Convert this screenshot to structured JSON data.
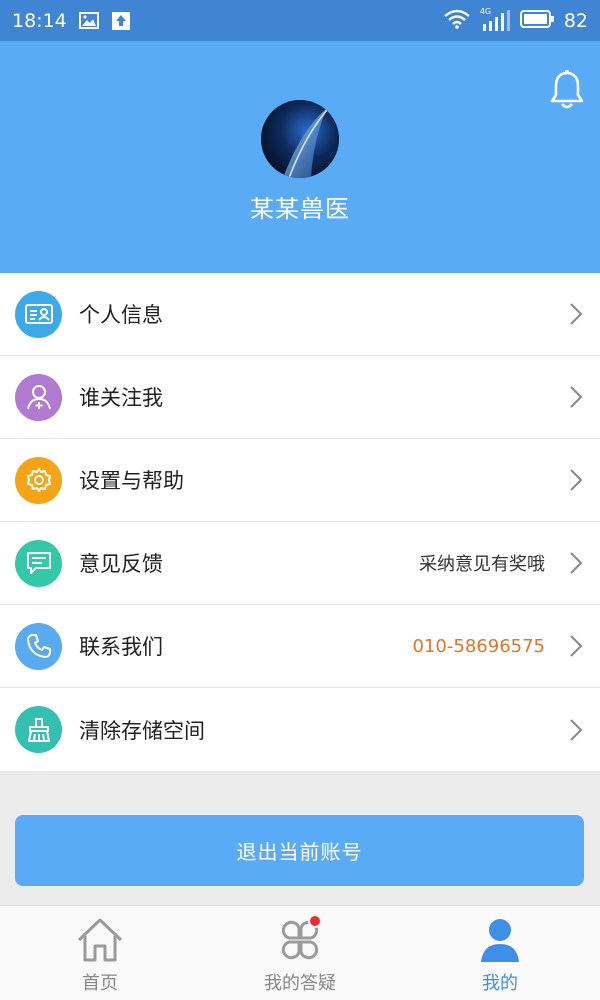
{
  "status_bar": {
    "time": "18:14",
    "network": "4G",
    "battery": "82"
  },
  "header": {
    "username": "某某兽医"
  },
  "menu": [
    {
      "label": "个人信息",
      "extra": "",
      "icon": "id-card-icon",
      "color": "#3ea9ea"
    },
    {
      "label": "谁关注我",
      "extra": "",
      "icon": "user-plus-icon",
      "color": "#b07bd0"
    },
    {
      "label": "设置与帮助",
      "extra": "",
      "icon": "gear-icon",
      "color": "#f5a317"
    },
    {
      "label": "意见反馈",
      "extra": "采纳意见有奖哦",
      "icon": "message-icon",
      "color": "#34c9a6"
    },
    {
      "label": "联系我们",
      "extra": "010-58696575",
      "icon": "phone-icon",
      "color": "#5aaaf0"
    },
    {
      "label": "清除存储空间",
      "extra": "",
      "icon": "broom-icon",
      "color": "#34c0b0"
    }
  ],
  "logout_label": "退出当前账号",
  "tabs": [
    {
      "label": "首页",
      "icon": "home-icon",
      "active": false
    },
    {
      "label": "我的答疑",
      "icon": "clover-icon",
      "active": false,
      "badge": true
    },
    {
      "label": "我的",
      "icon": "person-icon",
      "active": true
    }
  ],
  "colors": {
    "header": "#5aabf6",
    "status_bar": "#3f85d3",
    "accent_tab": "#3f8fe8",
    "phone": "#e0762a",
    "badge": "#e8302f"
  }
}
